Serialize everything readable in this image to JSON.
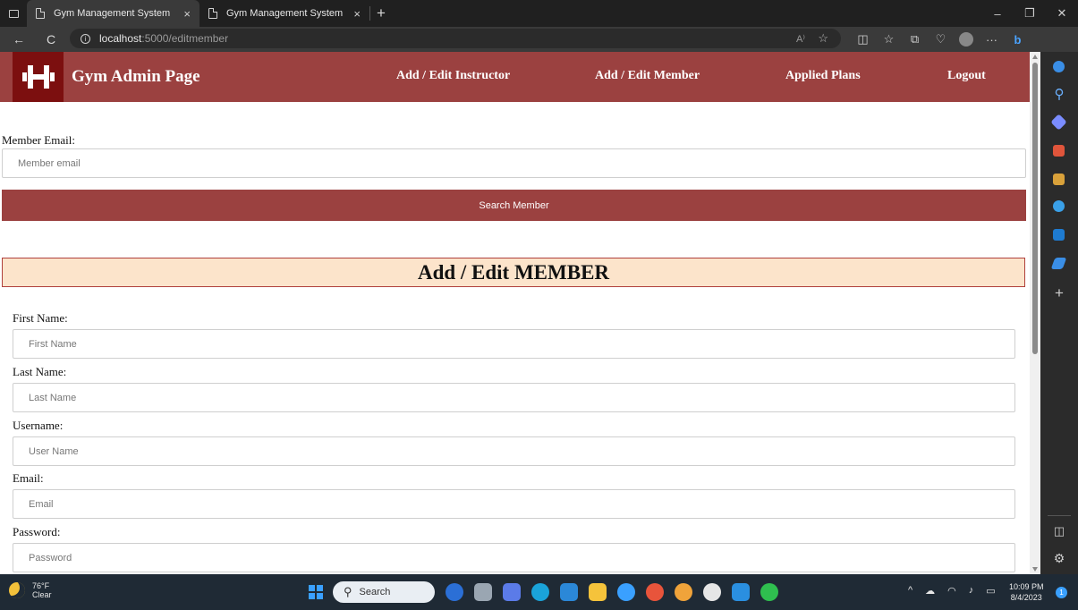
{
  "browser": {
    "tabs": [
      {
        "title": "Gym Management System",
        "close": "×"
      },
      {
        "title": "Gym Management System",
        "close": "×"
      }
    ],
    "new_tab": "+",
    "window_controls": {
      "minimize": "–",
      "restore": "❐",
      "close": "✕"
    },
    "back": "←",
    "reload": "C",
    "url_host": "localhost",
    "url_path": ":5000/editmember",
    "read_aloud": "A⁾"
  },
  "navbar": {
    "brand": "Gym Admin Page",
    "links": [
      "Add / Edit Instructor",
      "Add / Edit Member",
      "Applied Plans",
      "Logout"
    ],
    "colors": {
      "bar": "#9b4140",
      "logo_bg": "#7c0f0f"
    }
  },
  "search": {
    "label": "Member Email:",
    "placeholder": "Member email",
    "button": "Search Member"
  },
  "form": {
    "heading": "Add / Edit MEMBER",
    "fields": [
      {
        "label": "First Name:",
        "placeholder": "First Name"
      },
      {
        "label": "Last Name:",
        "placeholder": "Last Name"
      },
      {
        "label": "Username:",
        "placeholder": "User Name"
      },
      {
        "label": "Email:",
        "placeholder": "Email"
      },
      {
        "label": "Password:",
        "placeholder": "Password"
      }
    ]
  },
  "taskbar": {
    "weather_temp": "76°F",
    "weather_desc": "Clear",
    "search_label": "Search",
    "time": "10:09 PM",
    "date": "8/4/2023",
    "notifications": "1"
  }
}
